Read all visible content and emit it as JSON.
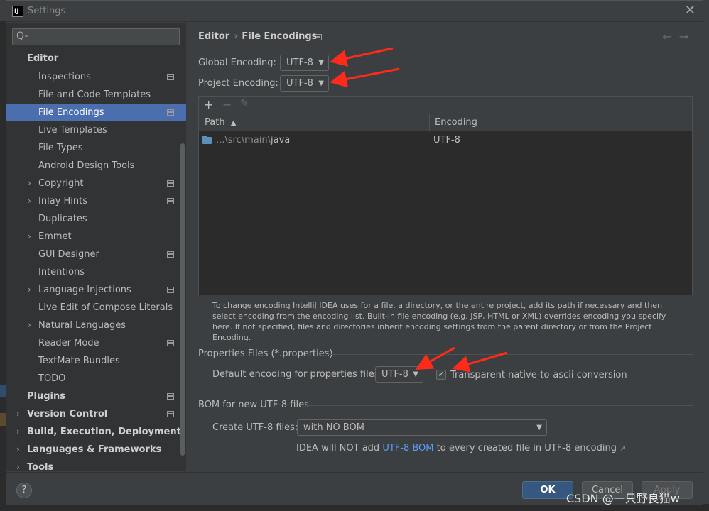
{
  "window": {
    "title": "Settings",
    "app_icon_text": "IJ"
  },
  "search": {
    "placeholder": "Q-"
  },
  "sidebar": {
    "items": [
      {
        "label": "Editor",
        "bold": true
      },
      {
        "label": "Inspections",
        "has_settings_icon": true
      },
      {
        "label": "File and Code Templates"
      },
      {
        "label": "File Encodings",
        "selected": true,
        "has_settings_icon": true
      },
      {
        "label": "Live Templates"
      },
      {
        "label": "File Types"
      },
      {
        "label": "Android Design Tools"
      },
      {
        "label": "Copyright",
        "expandable": true,
        "has_settings_icon": true
      },
      {
        "label": "Inlay Hints",
        "expandable": true,
        "has_settings_icon": true
      },
      {
        "label": "Duplicates"
      },
      {
        "label": "Emmet",
        "expandable": true
      },
      {
        "label": "GUI Designer",
        "has_settings_icon": true
      },
      {
        "label": "Intentions"
      },
      {
        "label": "Language Injections",
        "expandable": true,
        "has_settings_icon": true
      },
      {
        "label": "Live Edit of Compose Literals"
      },
      {
        "label": "Natural Languages",
        "expandable": true
      },
      {
        "label": "Reader Mode",
        "has_settings_icon": true
      },
      {
        "label": "TextMate Bundles"
      },
      {
        "label": "TODO"
      },
      {
        "label": "Plugins",
        "bold": true,
        "has_settings_icon": true
      },
      {
        "label": "Version Control",
        "bold": true,
        "expandable": true,
        "has_settings_icon": true
      },
      {
        "label": "Build, Execution, Deployment",
        "bold": true,
        "expandable": true
      },
      {
        "label": "Languages & Frameworks",
        "bold": true,
        "expandable": true
      },
      {
        "label": "Tools",
        "bold": true,
        "expandable": true
      }
    ]
  },
  "breadcrumb": {
    "parent": "Editor",
    "separator": "›",
    "current": "File Encodings"
  },
  "nav": {
    "back": "←",
    "forward": "→"
  },
  "global_encoding": {
    "label": "Global Encoding:",
    "value": "UTF-8"
  },
  "project_encoding": {
    "label": "Project Encoding:",
    "value": "UTF-8"
  },
  "table": {
    "toolbar": {
      "add": "+",
      "remove": "−",
      "edit": "✎"
    },
    "columns": [
      "Path",
      "Encoding"
    ],
    "sort_indicator": "▲",
    "rows": [
      {
        "path_prefix": "...\\src\\main\\",
        "path_name": "java",
        "encoding": "UTF-8"
      }
    ]
  },
  "help_text": "To change encoding IntelliJ IDEA uses for a file, a directory, or the entire project, add its path if necessary and then select encoding from the encoding list. Built-in file encoding (e.g. JSP, HTML or XML) overrides encoding you specify here. If not specified, files and directories inherit encoding settings from the parent directory or from the Project Encoding.",
  "properties": {
    "section_title": "Properties Files (*.properties)",
    "default_label": "Default encoding for properties files:",
    "default_value": "UTF-8",
    "transparent_label": "Transparent native-to-ascii conversion",
    "transparent_checked": true
  },
  "bom": {
    "section_title": "BOM for new UTF-8 files",
    "create_label": "Create UTF-8 files:",
    "create_value": "with NO BOM",
    "note_prefix": "IDEA will NOT add ",
    "note_link": "UTF-8 BOM",
    "note_suffix": " to every created file in UTF-8 encoding",
    "note_ext": "↗"
  },
  "footer": {
    "help": "?",
    "ok": "OK",
    "cancel": "Cancel",
    "apply": "Apply"
  },
  "watermark": "CSDN @一只野良猫w",
  "colors": {
    "background": "#3c3f41",
    "sidebar": "#313335",
    "selection": "#4b6eaf",
    "ok_button": "#365880",
    "link": "#589df6",
    "annotation_arrow": "#ff2a1a"
  }
}
